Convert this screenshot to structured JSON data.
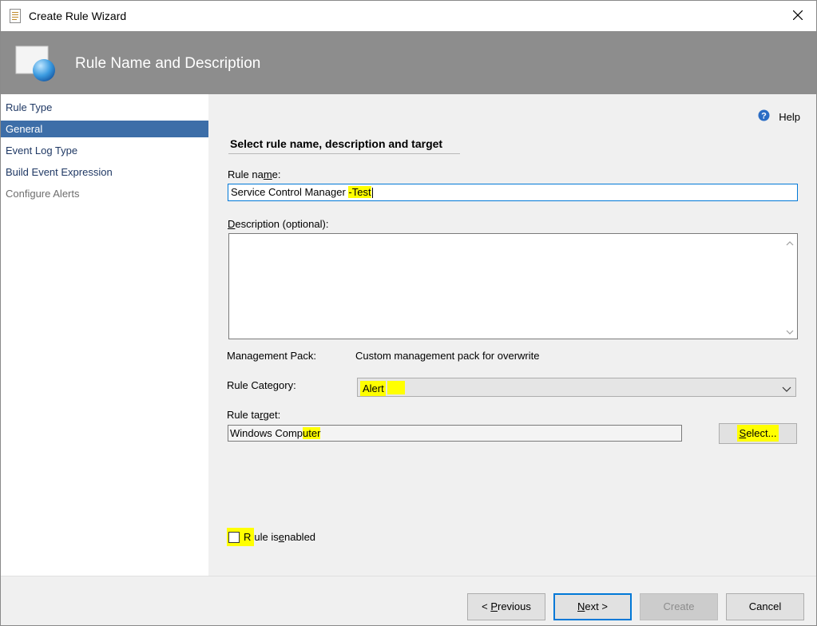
{
  "window": {
    "title": "Create Rule Wizard"
  },
  "banner": {
    "title": "Rule Name and Description"
  },
  "nav": {
    "items": [
      {
        "label": "Rule Type",
        "state": "normal"
      },
      {
        "label": "General",
        "state": "selected"
      },
      {
        "label": "Event Log Type",
        "state": "normal"
      },
      {
        "label": "Build Event Expression",
        "state": "normal"
      },
      {
        "label": "Configure Alerts",
        "state": "disabled"
      }
    ]
  },
  "help": {
    "label": "Help"
  },
  "form": {
    "section_title": "Select rule name, description and target",
    "rule_name": {
      "label_pre": "Rule na",
      "label_u": "m",
      "label_post": "e:",
      "value_pre": "Service Control Manager ",
      "value_hl": "-Test"
    },
    "description": {
      "label_u": "D",
      "label_post": "escription (optional):",
      "value": ""
    },
    "management_pack": {
      "label": "Management Pack:",
      "value": "Custom management pack for overwrite"
    },
    "rule_category": {
      "label": "Rule Category:",
      "value": "Alert"
    },
    "rule_target": {
      "label_pre": "Rule ta",
      "label_u": "r",
      "label_post": "get:",
      "value_pre": "Windows Comp",
      "value_hl": "uter",
      "select_u": "S",
      "select_post": "elect..."
    },
    "enabled": {
      "label_pre": "R",
      "label_mid": "ule is ",
      "label_u": "e",
      "label_post": "nabled",
      "checked": false
    }
  },
  "footer": {
    "previous": {
      "pre": "< ",
      "u": "P",
      "post": "revious"
    },
    "next": {
      "u": "N",
      "post": "ext >"
    },
    "create": "Create",
    "cancel": "Cancel"
  },
  "colors": {
    "banner": "#8d8d8d",
    "selected_nav": "#3d6ea8",
    "highlight": "#ffff00",
    "focus": "#0078d7"
  }
}
